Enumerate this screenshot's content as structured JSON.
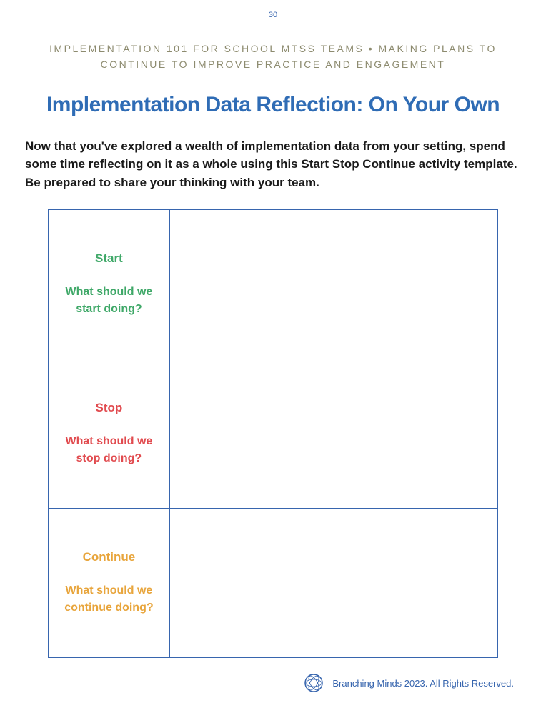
{
  "page_number": "30",
  "header_label": "IMPLEMENTATION 101 FOR SCHOOL MTSS TEAMS • MAKING PLANS TO CONTINUE TO IMPROVE PRACTICE AND ENGAGEMENT",
  "main_title": "Implementation Data Reflection: On Your Own",
  "intro_text": "Now that you've explored a wealth of implementation data from your setting, spend some time reflecting on it as a whole using this Start Stop Continue activity template.  Be prepared to share your thinking with your team.",
  "sections": {
    "start": {
      "label": "Start",
      "question": "What should we start doing?"
    },
    "stop": {
      "label": "Stop",
      "question": "What should we stop doing?"
    },
    "continue": {
      "label": "Continue",
      "question": "What should we continue doing?"
    }
  },
  "footer_text": "Branching Minds 2023.  All Rights Reserved."
}
